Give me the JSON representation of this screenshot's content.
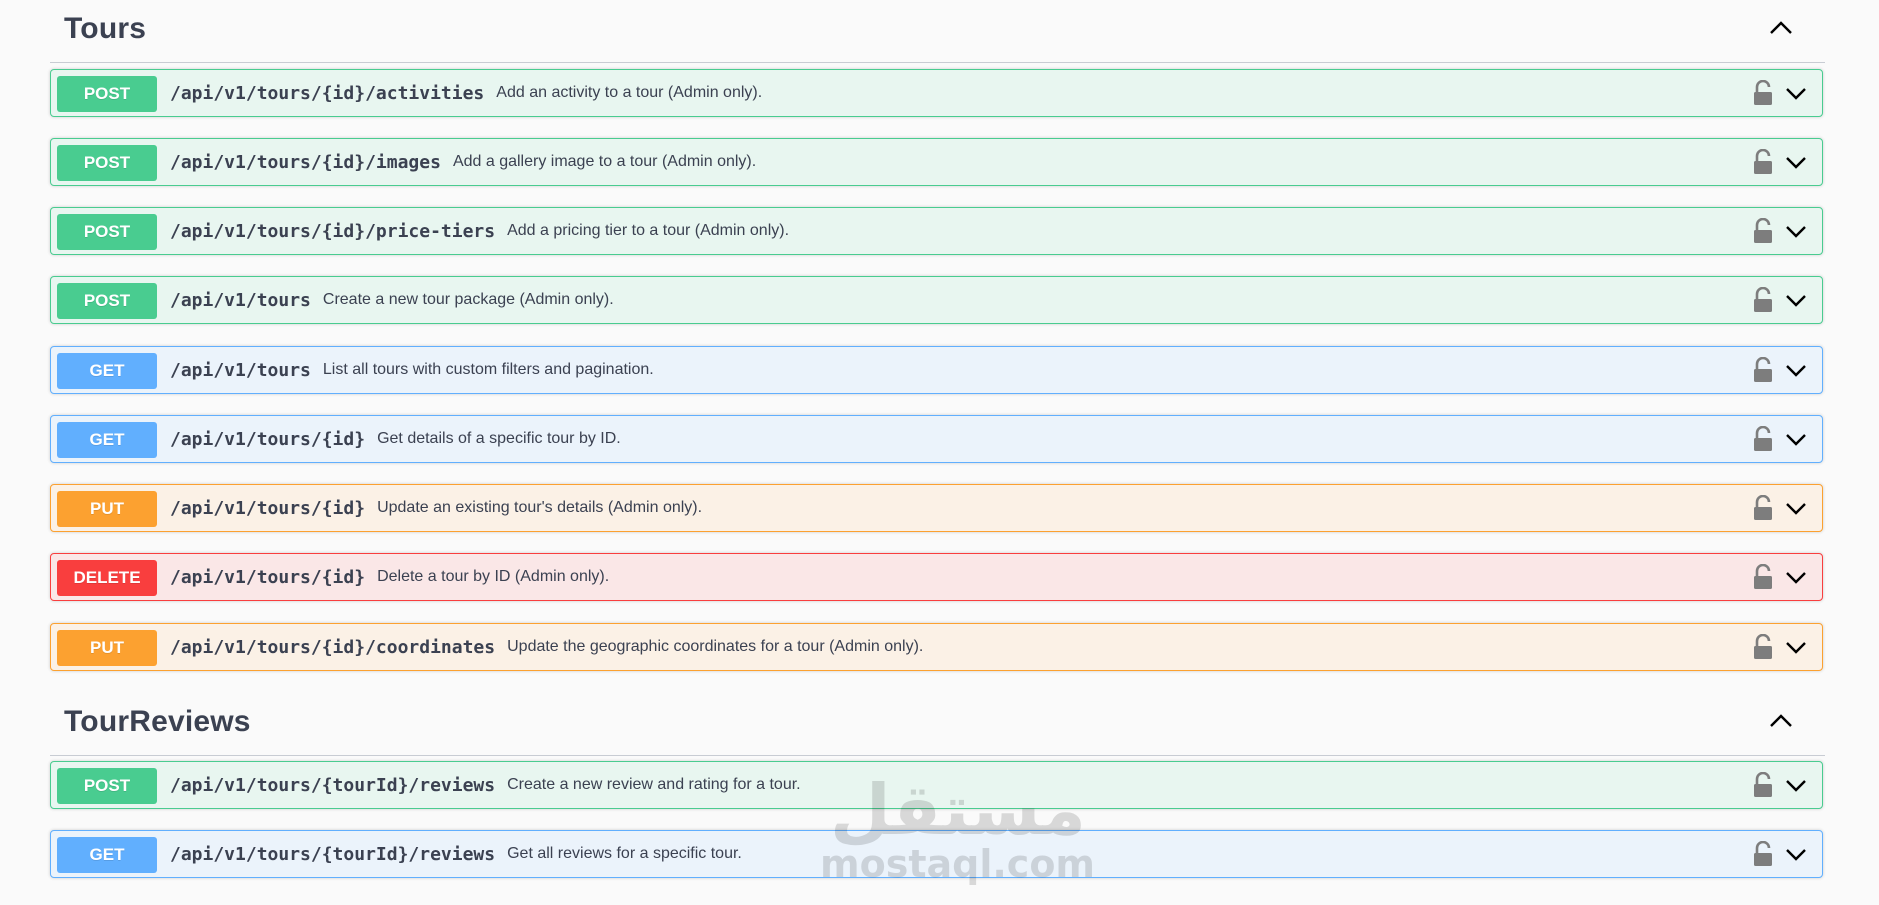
{
  "sections": [
    {
      "title": "Tours",
      "operations": [
        {
          "method": "POST",
          "path": "/api/v1/tours/{id}/activities",
          "summary": "Add an activity to a tour (Admin only)."
        },
        {
          "method": "POST",
          "path": "/api/v1/tours/{id}/images",
          "summary": "Add a gallery image to a tour (Admin only)."
        },
        {
          "method": "POST",
          "path": "/api/v1/tours/{id}/price-tiers",
          "summary": "Add a pricing tier to a tour (Admin only)."
        },
        {
          "method": "POST",
          "path": "/api/v1/tours",
          "summary": "Create a new tour package (Admin only)."
        },
        {
          "method": "GET",
          "path": "/api/v1/tours",
          "summary": "List all tours with custom filters and pagination."
        },
        {
          "method": "GET",
          "path": "/api/v1/tours/{id}",
          "summary": "Get details of a specific tour by ID."
        },
        {
          "method": "PUT",
          "path": "/api/v1/tours/{id}",
          "summary": "Update an existing tour's details (Admin only)."
        },
        {
          "method": "DELETE",
          "path": "/api/v1/tours/{id}",
          "summary": "Delete a tour by ID (Admin only)."
        },
        {
          "method": "PUT",
          "path": "/api/v1/tours/{id}/coordinates",
          "summary": "Update the geographic coordinates for a tour (Admin only)."
        }
      ]
    },
    {
      "title": "TourReviews",
      "operations": [
        {
          "method": "POST",
          "path": "/api/v1/tours/{tourId}/reviews",
          "summary": "Create a new review and rating for a tour."
        },
        {
          "method": "GET",
          "path": "/api/v1/tours/{tourId}/reviews",
          "summary": "Get all reviews for a specific tour."
        }
      ]
    }
  ],
  "watermark": {
    "arabic": "مستقل",
    "latin": "mostaql.com"
  },
  "colors": {
    "post": "#49cc90",
    "get": "#61affe",
    "put": "#fca130",
    "delete": "#f93e3e",
    "text": "#3b4151"
  },
  "icons": {
    "lock": "lock-icon",
    "expand": "chevron-down-icon",
    "collapse": "chevron-up-icon"
  }
}
